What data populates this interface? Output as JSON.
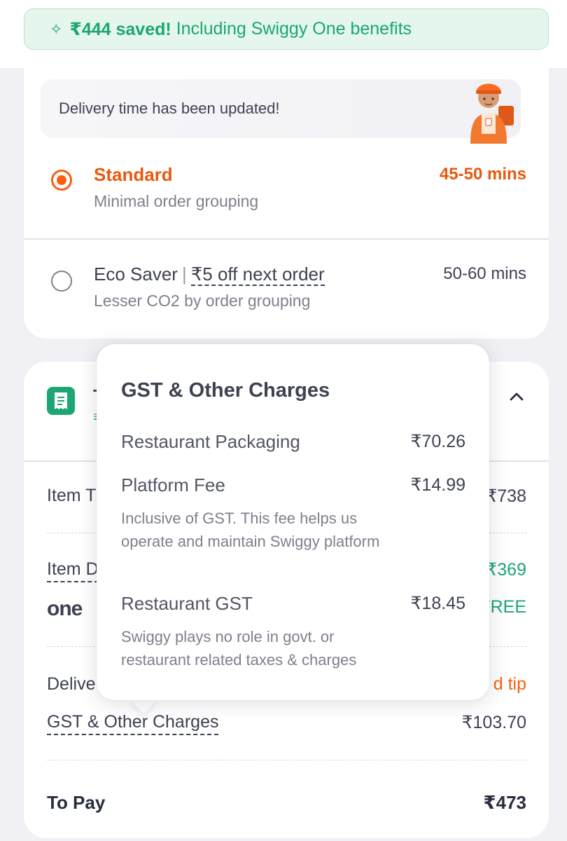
{
  "savings": {
    "icon": "sparkle-icon",
    "amount": "₹444 saved!",
    "text": "Including Swiggy One benefits"
  },
  "delivery": {
    "banner_text": "Delivery time has been updated!",
    "options": [
      {
        "title": "Standard",
        "subtitle": "Minimal order grouping",
        "time": "45-50 mins",
        "selected": true
      },
      {
        "title": "Eco Saver",
        "divider": "|",
        "offer": "₹5 off next order",
        "subtitle": "Lesser CO2 by order grouping",
        "time": "50-60 mins",
        "selected": false
      }
    ]
  },
  "bill": {
    "header_title": "T",
    "header_sub": "₹",
    "rows": {
      "item_total_label": "Item T",
      "item_total_value": "₹738",
      "item_discount_label": "Item D",
      "item_discount_value": "₹369",
      "one_label": "one",
      "one_value": "FREE",
      "delivery_label": "Delive",
      "delivery_value": "d tip",
      "gst_label": "GST & Other Charges",
      "gst_value": "₹103.70",
      "to_pay_label": "To Pay",
      "to_pay_value": "₹473"
    }
  },
  "popup": {
    "title": "GST & Other Charges",
    "items": [
      {
        "label": "Restaurant Packaging",
        "value": "₹70.26",
        "desc": ""
      },
      {
        "label": "Platform Fee",
        "value": "₹14.99",
        "desc": "Inclusive of GST. This fee helps us operate and maintain Swiggy platform"
      },
      {
        "label": "Restaurant GST",
        "value": "₹18.45",
        "desc": "Swiggy plays no role in govt. or restaurant related taxes & charges"
      }
    ]
  },
  "colors": {
    "accent": "#fc5f0f",
    "green": "#1ba672",
    "text": "#3d4152"
  }
}
